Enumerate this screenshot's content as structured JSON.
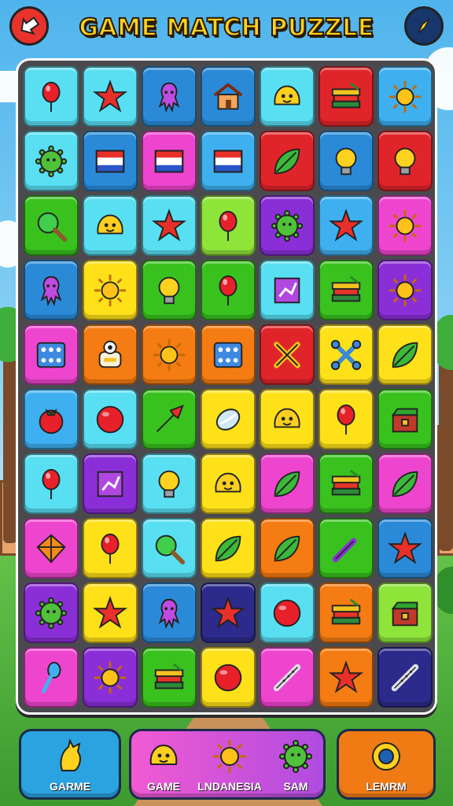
{
  "header": {
    "title": "GAME MATCH PUZZLE",
    "back_icon": "back-arrow-icon",
    "settings_icon": "compass-icon"
  },
  "colors": {
    "red": "#e0252a",
    "blue": "#2a8ad8",
    "cyan": "#58dff2",
    "green": "#39c21e",
    "yellow": "#ffe11a",
    "orange": "#f47c12",
    "magenta": "#ee45cf",
    "purple": "#8a2fd8",
    "navy": "#2c2a8a",
    "lime": "#8fe43a",
    "sky": "#3fb0ef"
  },
  "board": {
    "rows": [
      [
        [
          "cyan",
          "balloon-icon"
        ],
        [
          "cyan",
          "star-icon"
        ],
        [
          "blue",
          "squid-icon"
        ],
        [
          "blue",
          "house-icon"
        ],
        [
          "cyan",
          "blob-icon"
        ],
        [
          "red",
          "books-icon"
        ],
        [
          "sky",
          "sun-icon"
        ]
      ],
      [
        [
          "cyan",
          "germ-icon"
        ],
        [
          "blue",
          "flag-icon"
        ],
        [
          "magenta",
          "flag-icon"
        ],
        [
          "sky",
          "flag-icon"
        ],
        [
          "red",
          "leaf-icon"
        ],
        [
          "blue",
          "bulb-icon"
        ],
        [
          "red",
          "bulb-icon"
        ]
      ],
      [
        [
          "green",
          "magnifier-icon"
        ],
        [
          "cyan",
          "blob-icon"
        ],
        [
          "cyan",
          "star-icon"
        ],
        [
          "lime",
          "balloon-icon"
        ],
        [
          "purple",
          "germ-icon"
        ],
        [
          "sky",
          "star-icon"
        ],
        [
          "magenta",
          "sun-icon"
        ]
      ],
      [
        [
          "blue",
          "squid-icon"
        ],
        [
          "yellow",
          "sun-icon"
        ],
        [
          "green",
          "bulb-icon"
        ],
        [
          "green",
          "balloon-icon"
        ],
        [
          "cyan",
          "map-icon"
        ],
        [
          "green",
          "books-icon"
        ],
        [
          "purple",
          "sun-icon"
        ]
      ],
      [
        [
          "magenta",
          "dice-icon"
        ],
        [
          "orange",
          "robot-icon"
        ],
        [
          "orange",
          "sun-icon"
        ],
        [
          "orange",
          "dice-icon"
        ],
        [
          "red",
          "cross-icon"
        ],
        [
          "yellow",
          "bone-icon"
        ],
        [
          "yellow",
          "leaf-icon"
        ]
      ],
      [
        [
          "sky",
          "tomato-icon"
        ],
        [
          "cyan",
          "ball-icon"
        ],
        [
          "green",
          "arrow-icon"
        ],
        [
          "yellow",
          "gem-icon"
        ],
        [
          "yellow",
          "blob-icon"
        ],
        [
          "yellow",
          "balloon-icon"
        ],
        [
          "green",
          "chest-icon"
        ]
      ],
      [
        [
          "cyan",
          "balloon-icon"
        ],
        [
          "purple",
          "map-icon"
        ],
        [
          "cyan",
          "bulb-icon"
        ],
        [
          "yellow",
          "blob-icon"
        ],
        [
          "magenta",
          "leaf-icon"
        ],
        [
          "green",
          "books-icon"
        ],
        [
          "magenta",
          "leaf-icon"
        ]
      ],
      [
        [
          "magenta",
          "kite-icon"
        ],
        [
          "yellow",
          "balloon-icon"
        ],
        [
          "cyan",
          "magnifier-icon"
        ],
        [
          "yellow",
          "leaf-icon"
        ],
        [
          "orange",
          "leaf-icon"
        ],
        [
          "green",
          "bat-icon"
        ],
        [
          "blue",
          "star-icon"
        ]
      ],
      [
        [
          "purple",
          "germ-icon"
        ],
        [
          "yellow",
          "star-icon"
        ],
        [
          "blue",
          "squid-icon"
        ],
        [
          "navy",
          "star-icon"
        ],
        [
          "cyan",
          "ball-icon"
        ],
        [
          "orange",
          "books-icon"
        ],
        [
          "lime",
          "chest-icon"
        ]
      ],
      [
        [
          "magenta",
          "spoon-icon"
        ],
        [
          "purple",
          "sun-icon"
        ],
        [
          "green",
          "books-icon"
        ],
        [
          "yellow",
          "ball-icon"
        ],
        [
          "magenta",
          "flute-icon"
        ],
        [
          "orange",
          "star-icon"
        ],
        [
          "navy",
          "flute-icon"
        ]
      ]
    ]
  },
  "bottom": {
    "left": {
      "label": "GARME",
      "icon": "claw-icon"
    },
    "middle": [
      {
        "label": "GAME",
        "icon": "blob-icon"
      },
      {
        "label": "LNDANESIA",
        "icon": "sun-icon"
      },
      {
        "label": "SAM",
        "icon": "germ-icon"
      }
    ],
    "right": {
      "label": "LEMRM",
      "icon": "ring-icon"
    }
  }
}
